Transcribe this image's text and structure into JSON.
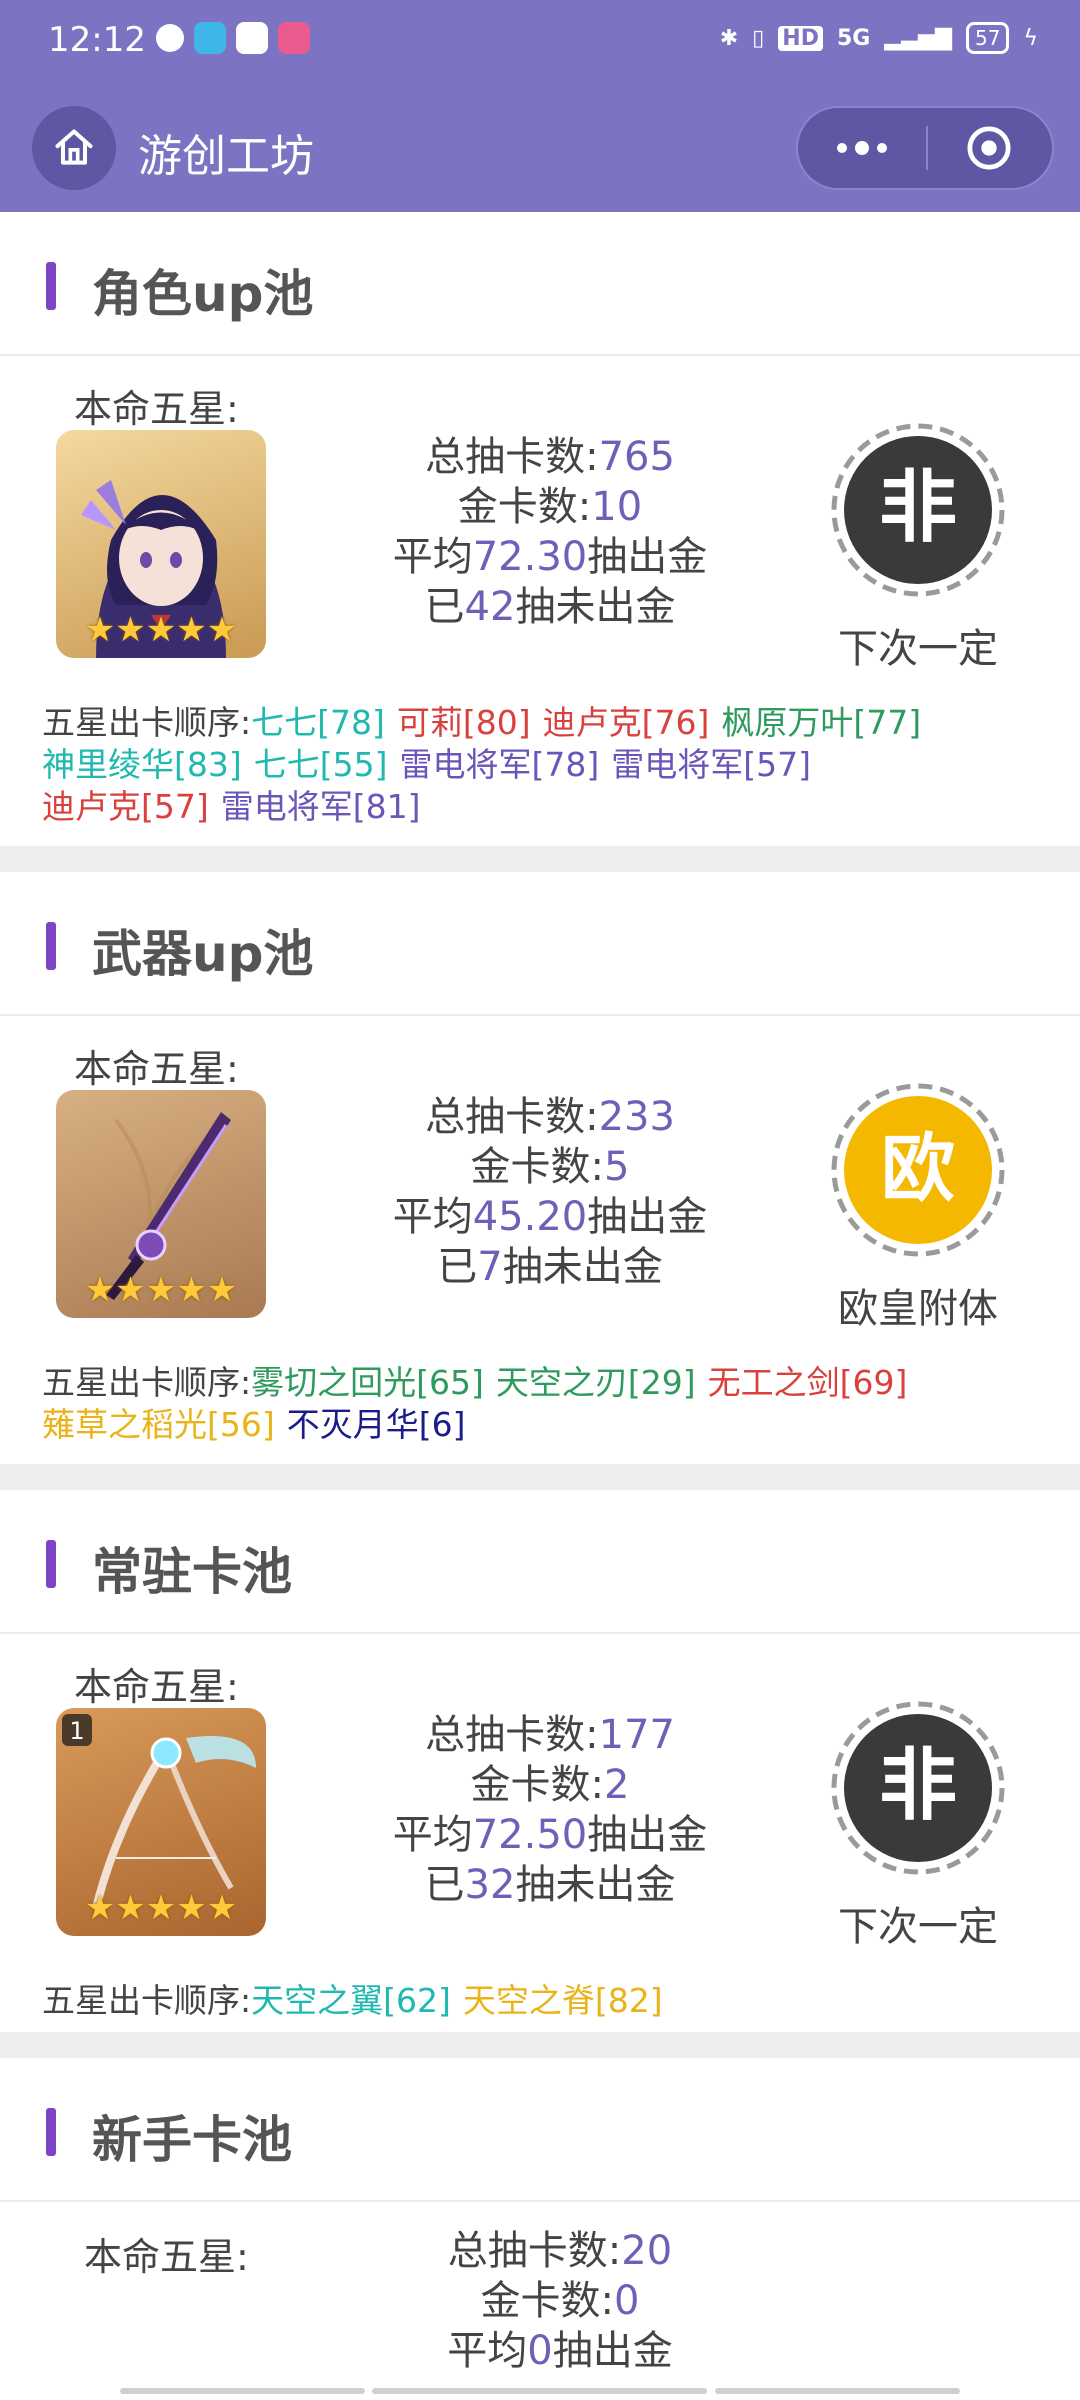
{
  "status_bar": {
    "time": "12:12",
    "signal": "5G",
    "battery": "57"
  },
  "nav": {
    "title": "游创工坊"
  },
  "sections": [
    {
      "title": "角色up池",
      "benming_label": "本命五星:",
      "stats": {
        "total_label": "总抽卡数:",
        "total_value": "765",
        "gold_label": "金卡数:",
        "gold_value": "10",
        "avg_prefix": "平均",
        "avg_value": "72.30",
        "avg_suffix": "抽出金",
        "since_prefix": "已",
        "since_value": "42",
        "since_suffix": "抽未出金"
      },
      "badge_char": "非",
      "badge_label": "下次一定",
      "order_label": "五星出卡顺序:",
      "order_items": [
        {
          "text": "七七[78]",
          "color": "#1fb9b0"
        },
        {
          "text": "可莉[80]",
          "color": "#d8413d"
        },
        {
          "text": "迪卢克[76]",
          "color": "#d8413d"
        },
        {
          "text": "枫原万叶[77]",
          "color": "#2e9a5d"
        },
        {
          "text": "神里绫华[83]",
          "color": "#1fb9b0"
        },
        {
          "text": "七七[55]",
          "color": "#1fb9b0"
        },
        {
          "text": "雷电将军[78]",
          "color": "#6b55b8"
        },
        {
          "text": "雷电将军[57]",
          "color": "#6b55b8"
        },
        {
          "text": "迪卢克[57]",
          "color": "#d8413d"
        },
        {
          "text": "雷电将军[81]",
          "color": "#6b55b8"
        }
      ]
    },
    {
      "title": "武器up池",
      "benming_label": "本命五星:",
      "stats": {
        "total_label": "总抽卡数:",
        "total_value": "233",
        "gold_label": "金卡数:",
        "gold_value": "5",
        "avg_prefix": "平均",
        "avg_value": "45.20",
        "avg_suffix": "抽出金",
        "since_prefix": "已",
        "since_value": "7",
        "since_suffix": "抽未出金"
      },
      "badge_char": "欧",
      "badge_label": "欧皇附体",
      "order_label": "五星出卡顺序:",
      "order_items": [
        {
          "text": "雾切之回光[65]",
          "color": "#2e9a5d"
        },
        {
          "text": "天空之刃[29]",
          "color": "#2e9a5d"
        },
        {
          "text": "无工之剑[69]",
          "color": "#d8413d"
        },
        {
          "text": "薙草之稻光[56]",
          "color": "#e9b31a"
        },
        {
          "text": "不灭月华[6]",
          "color": "#1a1c8a"
        }
      ]
    },
    {
      "title": "常驻卡池",
      "benming_label": "本命五星:",
      "stats": {
        "total_label": "总抽卡数:",
        "total_value": "177",
        "gold_label": "金卡数:",
        "gold_value": "2",
        "avg_prefix": "平均",
        "avg_value": "72.50",
        "avg_suffix": "抽出金",
        "since_prefix": "已",
        "since_value": "32",
        "since_suffix": "抽未出金"
      },
      "badge_char": "非",
      "badge_label": "下次一定",
      "order_label": "五星出卡顺序:",
      "order_items": [
        {
          "text": "天空之翼[62]",
          "color": "#1fb9b0"
        },
        {
          "text": "天空之脊[82]",
          "color": "#e9b31a"
        }
      ]
    },
    {
      "title": "新手卡池",
      "benming_label": "本命五星:",
      "stats": {
        "total_label": "总抽卡数:",
        "total_value": "20",
        "gold_label": "金卡数:",
        "gold_value": "0",
        "avg_prefix": "平均",
        "avg_value": "0",
        "avg_suffix": "抽出金"
      }
    }
  ],
  "colors": {
    "header_bg": "#7c74c2",
    "accent_bar": "#7d44c9",
    "stat_number": "#6b62b7",
    "badge_dark": "#3a3a3a",
    "badge_gold": "#f5b800"
  }
}
